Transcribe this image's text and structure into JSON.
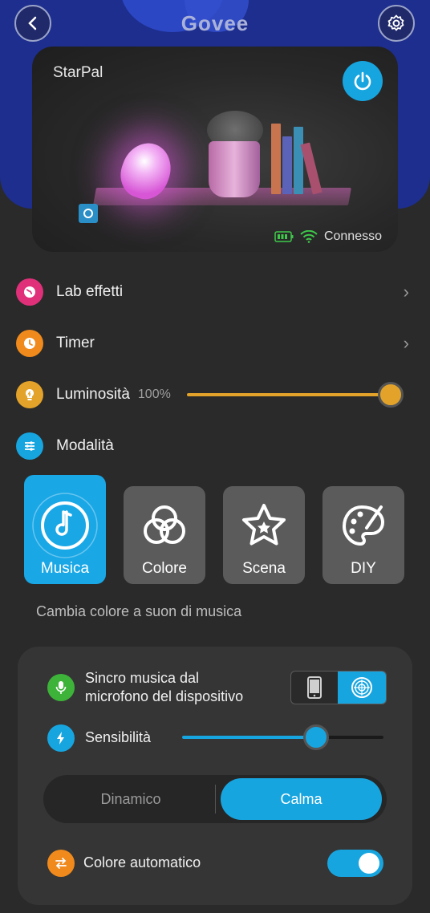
{
  "header": {
    "logo": "Govee",
    "back_icon": "chevron-left-icon",
    "settings_icon": "gear-icon"
  },
  "device": {
    "name": "StarPal",
    "status": "Connesso",
    "power_color": "#17a5e0"
  },
  "menu": {
    "lab": {
      "label": "Lab effetti",
      "color": "#e0307a"
    },
    "timer": {
      "label": "Timer",
      "color": "#f08a1c"
    },
    "brightness": {
      "label": "Luminosità",
      "value_text": "100%",
      "value": 1.0,
      "color": "#e3a32a"
    },
    "mode": {
      "label": "Modalità",
      "color": "#17a5e0"
    }
  },
  "modes": [
    {
      "label": "Musica",
      "icon": "music-note-icon",
      "active": true
    },
    {
      "label": "Colore",
      "icon": "color-circles-icon",
      "active": false
    },
    {
      "label": "Scena",
      "icon": "star-icon",
      "active": false
    },
    {
      "label": "DIY",
      "icon": "palette-icon",
      "active": false
    }
  ],
  "mode_description": "Cambia colore a suon di musica",
  "music": {
    "sync_label_line1": "Sincro musica dal",
    "sync_label_line2": "microfono del dispositivo",
    "sensitivity_label": "Sensibilità",
    "sensitivity_value": 0.69,
    "segments": [
      {
        "label": "Dinamico",
        "active": false
      },
      {
        "label": "Calma",
        "active": true
      }
    ],
    "auto_color_label": "Colore automatico",
    "auto_color_on": true
  }
}
